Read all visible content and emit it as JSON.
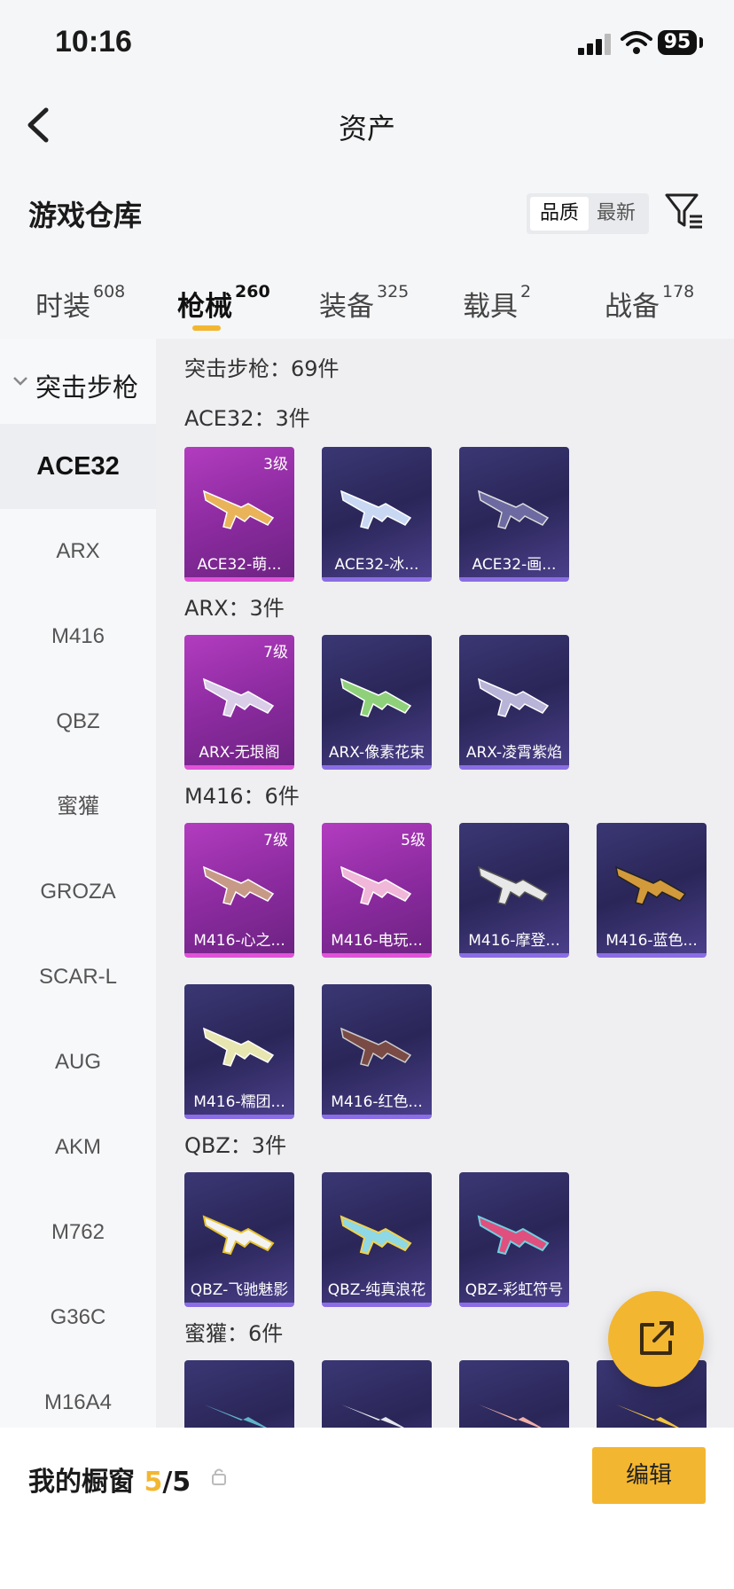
{
  "status": {
    "time": "10:16",
    "battery": "95"
  },
  "nav": {
    "title": "资产"
  },
  "warehouse": {
    "title": "游戏仓库",
    "sort_options": [
      "品质",
      "最新"
    ]
  },
  "tabs": [
    {
      "label": "时装",
      "count": "608"
    },
    {
      "label": "枪械",
      "count": "260"
    },
    {
      "label": "装备",
      "count": "325"
    },
    {
      "label": "载具",
      "count": "2"
    },
    {
      "label": "战备",
      "count": "178"
    }
  ],
  "sidebar": {
    "category": "突击步枪",
    "items": [
      "ACE32",
      "ARX",
      "M416",
      "QBZ",
      "蜜獾",
      "GROZA",
      "SCAR-L",
      "AUG",
      "AKM",
      "M762",
      "G36C",
      "M16A4"
    ]
  },
  "content": {
    "section_total": "突击步枪：69件",
    "groups": [
      {
        "title": "ACE32：3件",
        "cards": [
          {
            "label": "ACE32-萌...",
            "level": "3级",
            "rarity": "purple"
          },
          {
            "label": "ACE32-冰...",
            "level": "",
            "rarity": "blue"
          },
          {
            "label": "ACE32-画...",
            "level": "",
            "rarity": "blue"
          }
        ]
      },
      {
        "title": "ARX：3件",
        "cards": [
          {
            "label": "ARX-无垠阁",
            "level": "7级",
            "rarity": "purple"
          },
          {
            "label": "ARX-像素花束",
            "level": "",
            "rarity": "blue"
          },
          {
            "label": "ARX-凌霄紫焰",
            "level": "",
            "rarity": "blue"
          }
        ]
      },
      {
        "title": "M416：6件",
        "cards": [
          {
            "label": "M416-心之...",
            "level": "7级",
            "rarity": "purple"
          },
          {
            "label": "M416-电玩...",
            "level": "5级",
            "rarity": "purple"
          },
          {
            "label": "M416-摩登...",
            "level": "",
            "rarity": "blue"
          },
          {
            "label": "M416-蓝色...",
            "level": "",
            "rarity": "blue"
          },
          {
            "label": "M416-糯团...",
            "level": "",
            "rarity": "blue"
          },
          {
            "label": "M416-红色...",
            "level": "",
            "rarity": "blue"
          }
        ]
      },
      {
        "title": "QBZ：3件",
        "cards": [
          {
            "label": "QBZ-飞驰魅影",
            "level": "",
            "rarity": "blue"
          },
          {
            "label": "QBZ-纯真浪花",
            "level": "",
            "rarity": "blue"
          },
          {
            "label": "QBZ-彩虹符号",
            "level": "",
            "rarity": "blue"
          }
        ]
      },
      {
        "title": "蜜獾：6件",
        "cards": []
      }
    ]
  },
  "bottom": {
    "window_label": "我的橱窗",
    "used": "5",
    "total": "/5",
    "edit_label": "编辑"
  },
  "colors": {
    "accent": "#f3b630",
    "purple_card": "#9b30b0",
    "blue_card": "#2e2a62"
  },
  "icons": [
    "back-arrow-icon",
    "filter-icon",
    "chevron-down-icon",
    "share-icon",
    "lock-icon",
    "signal-icon",
    "wifi-icon"
  ]
}
